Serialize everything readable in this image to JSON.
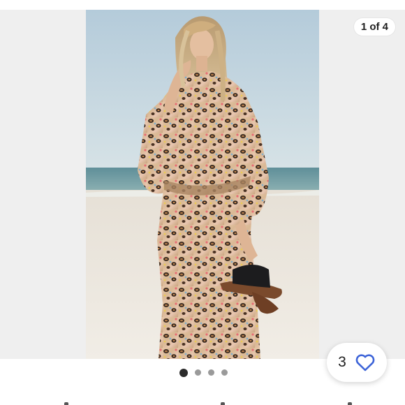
{
  "gallery": {
    "counter": "1 of 4",
    "current_slide": 1,
    "total_slides": 4
  },
  "like": {
    "count": "3"
  },
  "icons": {
    "like": "heart-outline-icon"
  },
  "colors": {
    "accent": "#3d64d8",
    "active_dot": "#2b2b2b",
    "inactive_dot": "#9a9a9a",
    "gallery_bg": "#efefef"
  }
}
